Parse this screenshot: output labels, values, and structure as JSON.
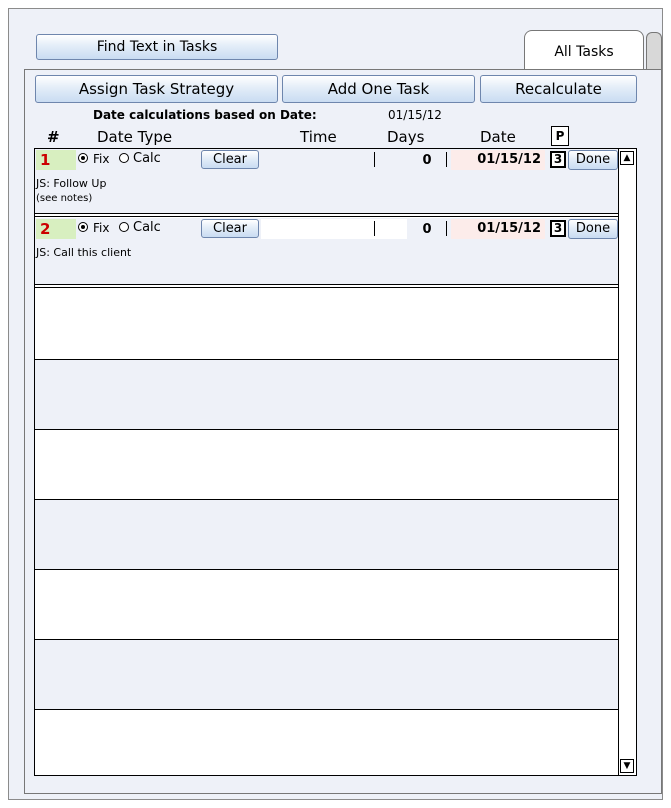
{
  "toolbar": {
    "find_text": "Find Text in Tasks",
    "assign_strategy": "Assign Task Strategy",
    "add_one_task": "Add One Task",
    "recalculate": "Recalculate"
  },
  "tabs": {
    "active": "All Tasks"
  },
  "based_on": {
    "label": "Date calculations based on Date:",
    "value": "01/15/12"
  },
  "columns": {
    "num": "#",
    "date_type": "Date Type",
    "time": "Time",
    "days": "Days",
    "date": "Date",
    "priority": "P"
  },
  "tasks": [
    {
      "num": "1",
      "fix": "Fix",
      "calc": "Calc",
      "selected": "Fix",
      "clear": "Clear",
      "days": "0",
      "date": "01/15/12",
      "priority": "3",
      "done": "Done",
      "note_1": "JS: Follow Up",
      "note_2": "(see notes)"
    },
    {
      "num": "2",
      "fix": "Fix",
      "calc": "Calc",
      "selected": "Fix",
      "clear": "Clear",
      "days": "0",
      "date": "01/15/12",
      "priority": "3",
      "done": "Done",
      "note_1": "JS: Call this client",
      "note_2": ""
    }
  ],
  "colors": {
    "accent_button": "#c9dcf2",
    "panel": "#eef1f8",
    "number_cell": "#d8efc0",
    "number_text": "#cc0000",
    "date_cell": "#fcecea"
  },
  "icons": {
    "scroll_up": "triangle-up-icon",
    "scroll_down": "triangle-down-icon"
  }
}
